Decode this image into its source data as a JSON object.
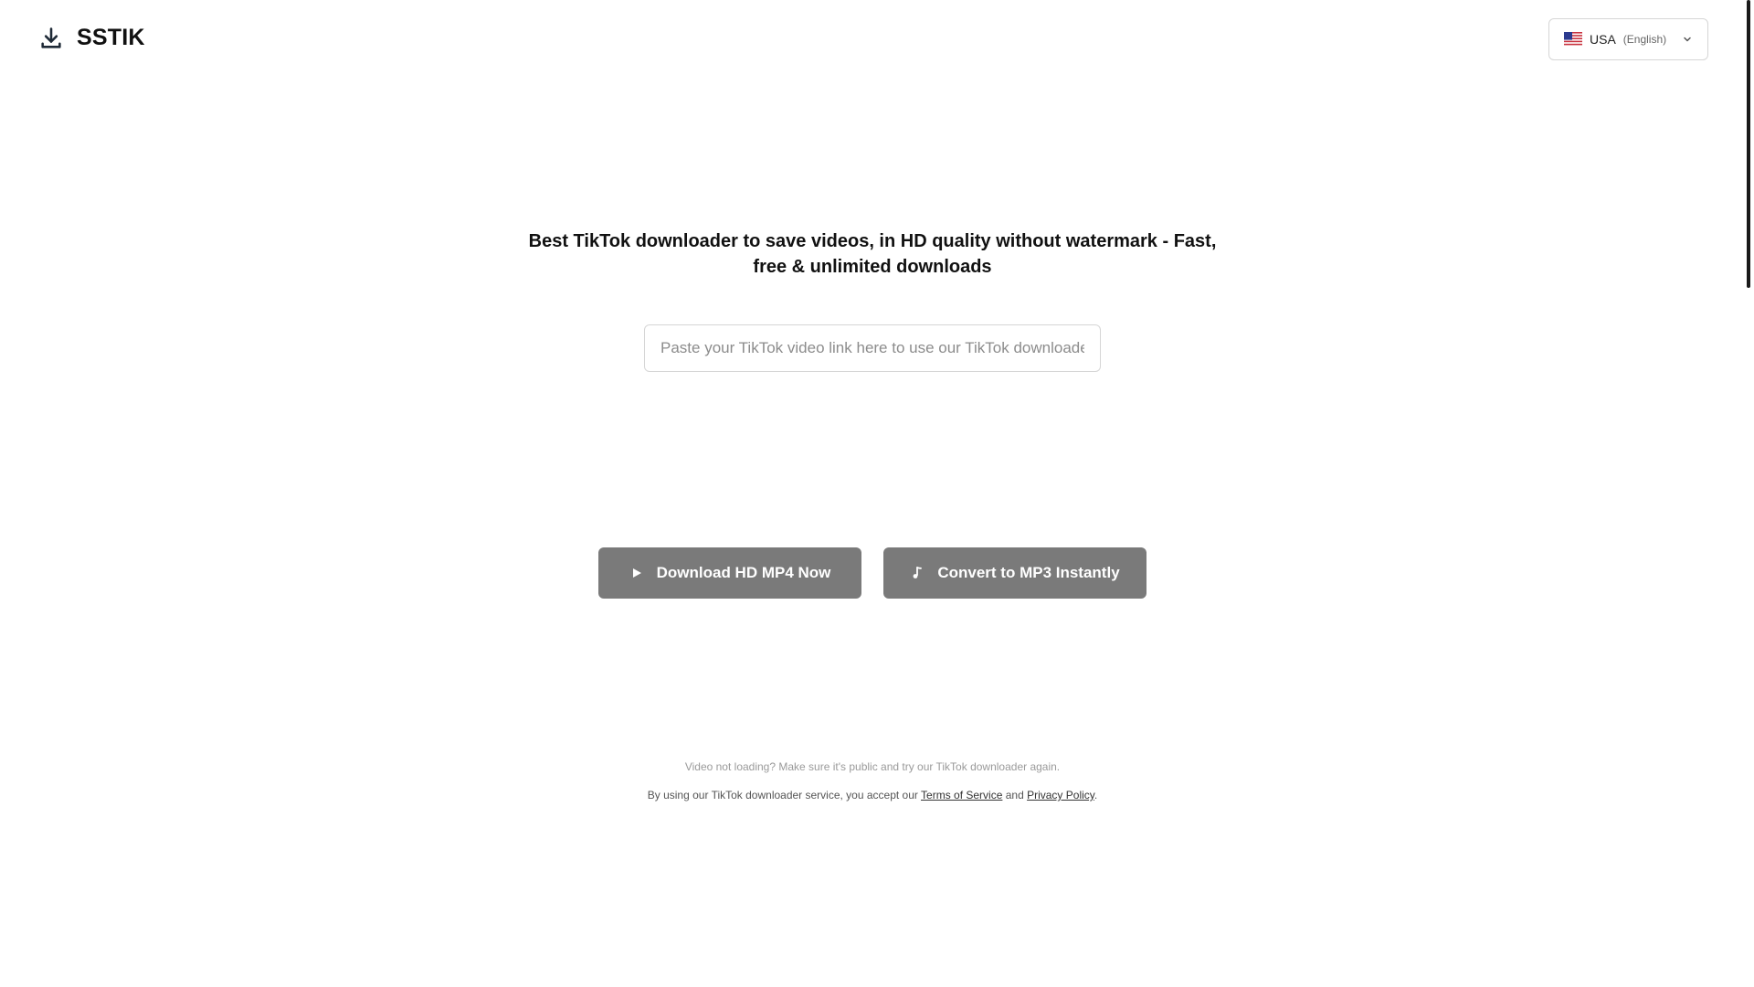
{
  "brand": {
    "name": "SSTIK",
    "icon": "download-icon"
  },
  "language": {
    "country": "USA",
    "name": "(English)",
    "flag_icon": "us-flag-icon"
  },
  "hero": {
    "headline": "Best TikTok downloader to save videos, in HD quality without watermark - Fast, free & unlimited downloads"
  },
  "search": {
    "value": "",
    "placeholder": "Paste your TikTok video link here to use our TikTok downloader..."
  },
  "actions": {
    "mp4_label": "Download HD MP4 Now",
    "mp4_icon": "play-icon",
    "mp3_label": "Convert to MP3 Instantly",
    "mp3_icon": "music-note-icon"
  },
  "footer": {
    "help_text": "Video not loading? Make sure it's public and try our TikTok downloader again.",
    "terms_prefix": "By using our TikTok downloader service, you accept our ",
    "terms_link": "Terms of Service",
    "terms_and": " and ",
    "privacy_link": "Privacy Policy",
    "terms_suffix": "."
  },
  "colors": {
    "button_bg": "#7a7a7a",
    "text": "#111111",
    "muted_text": "#9a9a9a"
  }
}
